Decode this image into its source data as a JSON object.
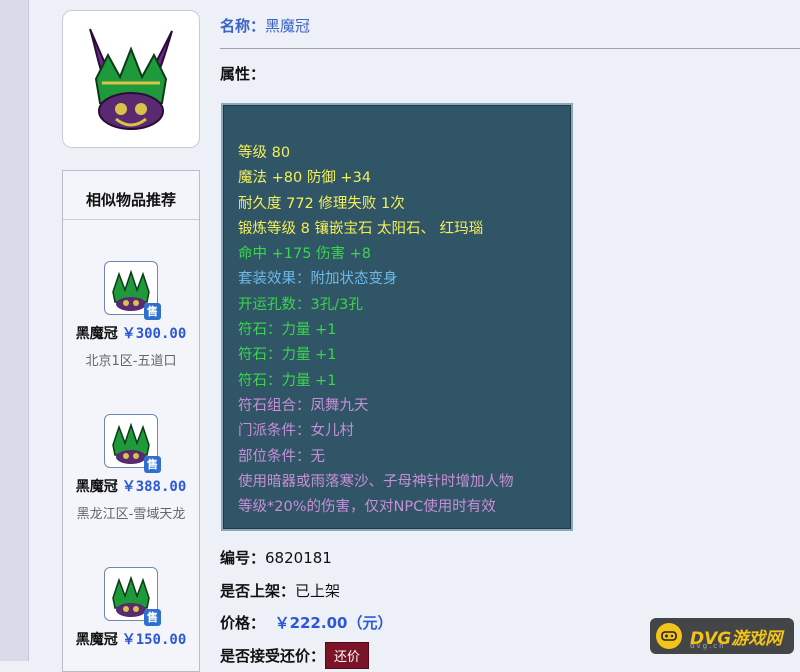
{
  "item": {
    "name_label": "名称：",
    "name_value": "黑魔冠",
    "attributes_label": "属性：",
    "icon": "crown-helmet-icon"
  },
  "attributes": [
    {
      "text": "等级 80",
      "color": "#f3ef5a"
    },
    {
      "text": "魔法 +80 防御 +34",
      "color": "#f3ef5a"
    },
    {
      "text": "耐久度 772 修理失败 1次",
      "color": "#f3ef5a"
    },
    {
      "text": "锻炼等级 8 镶嵌宝石 太阳石、 红玛瑙",
      "color": "#f3ef5a"
    },
    {
      "text": "命中 +175 伤害 +8",
      "color": "#39d64b"
    },
    {
      "text": "套装效果：附加状态变身",
      "color": "#6fb8e6"
    },
    {
      "text": "开运孔数：3孔/3孔",
      "color": "#39d64b"
    },
    {
      "text": "符石：力量 +1",
      "color": "#39d64b"
    },
    {
      "text": "符石：力量 +1",
      "color": "#39d64b"
    },
    {
      "text": "符石：力量 +1",
      "color": "#39d64b"
    },
    {
      "text": "符石组合：凤舞九天",
      "color": "#c98ed9"
    },
    {
      "text": "门派条件：女儿村",
      "color": "#c98ed9"
    },
    {
      "text": "部位条件：无",
      "color": "#c98ed9"
    },
    {
      "text": "使用暗器或雨落寒沙、子母神针时增加人物",
      "color": "#c98ed9"
    },
    {
      "text": "等级*20%的伤害，仅对NPC使用时有效",
      "color": "#c98ed9"
    }
  ],
  "details": {
    "id_label": "编号：",
    "id_value": "6820181",
    "listed_label": "是否上架：",
    "listed_value": "已上架",
    "price_label": "价格：",
    "price_value": "￥222.00（元）",
    "counter_label": "是否接受还价：",
    "counter_button": "还价"
  },
  "sidebar": {
    "title": "相似物品推荐",
    "sold_badge": "售",
    "items": [
      {
        "name": "黑魔冠",
        "price": "￥300.00",
        "server": "北京1区-五道口"
      },
      {
        "name": "黑魔冠",
        "price": "￥388.00",
        "server": "黑龙江区-雪域天龙"
      },
      {
        "name": "黑魔冠",
        "price": "￥150.00",
        "server": ""
      }
    ]
  },
  "watermark": {
    "text": "DVG游戏网",
    "sub": "dvg.cn",
    "icon": "gamepad-icon"
  }
}
